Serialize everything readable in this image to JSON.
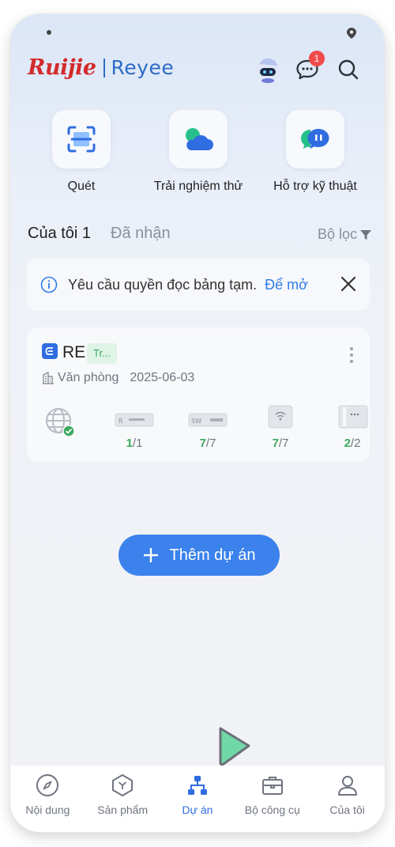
{
  "status_bar": {
    "icons": [
      "status-dot",
      "location-icon"
    ]
  },
  "header": {
    "brand_primary": "Ruijie",
    "brand_secondary": "Reyee",
    "chat_badge_count": "1"
  },
  "quick_actions": [
    {
      "label": "Quét",
      "icon": "scan-icon"
    },
    {
      "label": "Trải nghiệm thử",
      "icon": "cloud-icon"
    },
    {
      "label": "Hỗ trợ kỹ thuật",
      "icon": "support-chat-icon"
    }
  ],
  "tabs": {
    "mine": "Của tôi 1",
    "received": "Đã nhận",
    "filter_label": "Bộ lọc"
  },
  "notice": {
    "text": "Yêu cầu quyền đọc bảng tạm.",
    "link": "Để mở"
  },
  "project": {
    "name": "RE",
    "tag": "Tr...",
    "type": "Văn phòng",
    "date": "2025-06-03",
    "devices": [
      {
        "kind": "router",
        "online": "1",
        "total": "/1"
      },
      {
        "kind": "switch",
        "online": "7",
        "total": "/7"
      },
      {
        "kind": "access-point",
        "online": "7",
        "total": "/7"
      },
      {
        "kind": "other",
        "online": "2",
        "total": "/2"
      }
    ]
  },
  "add_project_label": "Thêm dự án",
  "bottom_nav": [
    {
      "label": "Nội dung",
      "icon": "compass-icon"
    },
    {
      "label": "Sản phẩm",
      "icon": "product-icon"
    },
    {
      "label": "Dự án",
      "icon": "project-icon"
    },
    {
      "label": "Bộ công cụ",
      "icon": "toolbox-icon"
    },
    {
      "label": "Của tôi",
      "icon": "user-icon"
    }
  ],
  "colors": {
    "accent": "#2f6de0",
    "brand_red": "#d42b2b",
    "online_green": "#3aaa5c",
    "badge_red": "#f04a4a"
  }
}
